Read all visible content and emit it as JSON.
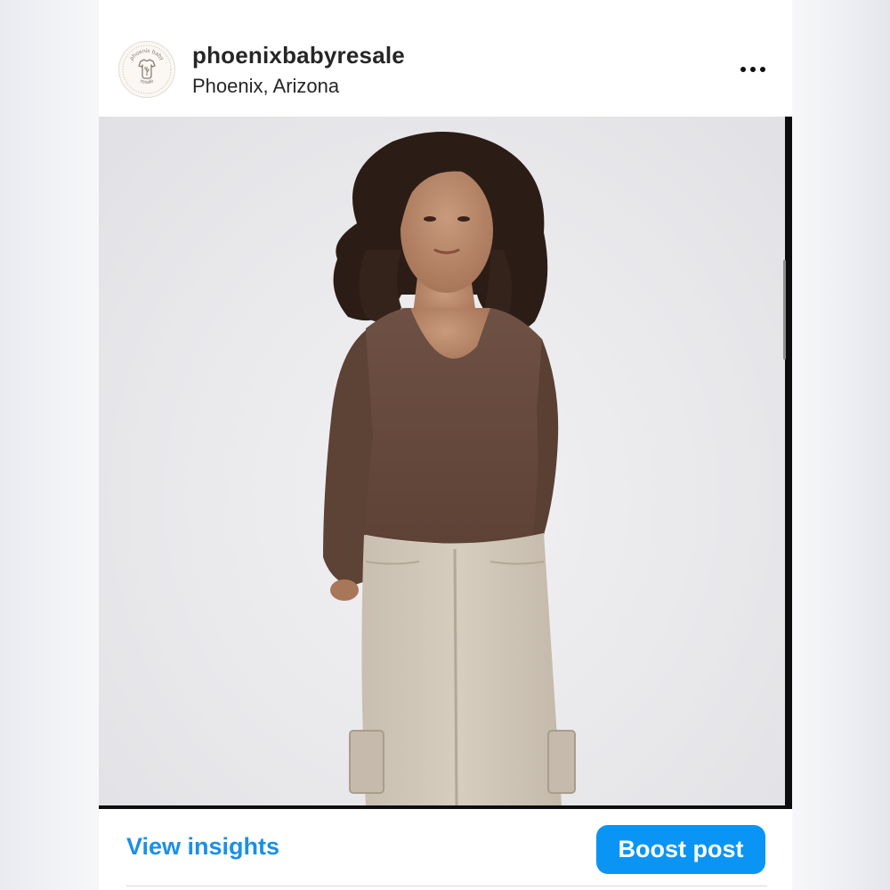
{
  "post": {
    "username": "phoenixbabyresale",
    "location": "Phoenix, Arizona",
    "avatar": {
      "logo_text_top": "phoenix baby",
      "logo_text_bottom": "resale",
      "icon": "onesie-cactus-logo"
    },
    "more_icon": "more-horizontal-icon",
    "image": {
      "description_icon": "product-photo",
      "subject": "model-in-brown-top-and-cargo-pants"
    }
  },
  "actions": {
    "view_insights_label": "View insights",
    "boost_post_label": "Boost post"
  },
  "colors": {
    "link_blue": "#1b8fe8",
    "button_blue": "#0a95f5",
    "text": "#262626"
  }
}
